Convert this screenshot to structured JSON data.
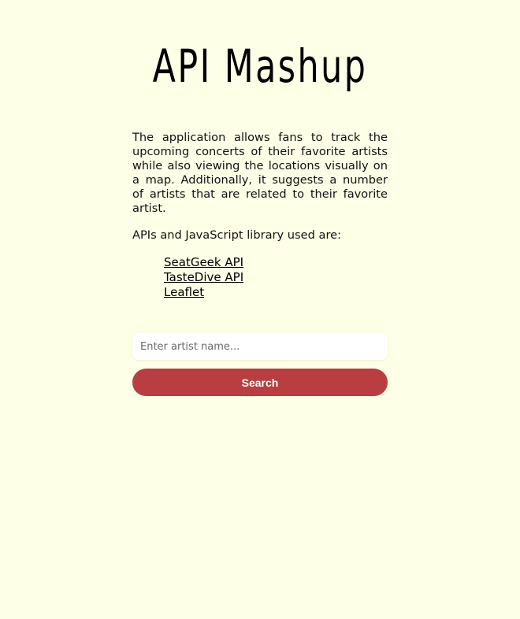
{
  "header": {
    "title": "API Mashup"
  },
  "intro": {
    "description": "The application allows fans to track the upcoming concerts of their favorite artists while also viewing the locations visually on a map. Additionally, it suggests a number of artists that are related to their favorite artist.",
    "apis_intro": "APIs and JavaScript library used are:"
  },
  "apis": [
    {
      "label": "SeatGeek API"
    },
    {
      "label": "TasteDive API"
    },
    {
      "label": "Leaflet"
    }
  ],
  "search": {
    "placeholder": "Enter artist name...",
    "value": "",
    "button_label": "Search"
  },
  "colors": {
    "background": "#fdffe6",
    "button": "#b83e42",
    "button_text": "#ffffff"
  }
}
